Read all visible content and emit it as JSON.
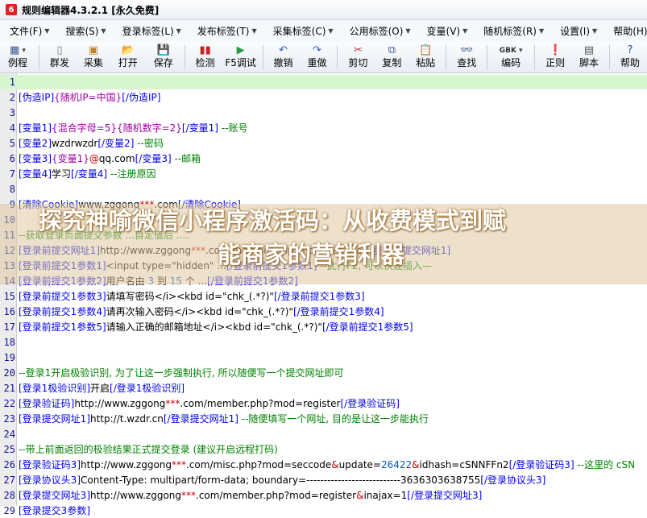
{
  "window": {
    "title": "规则编辑器4.3.2.1 [永久免费]",
    "icon_name": "app-logo-icon"
  },
  "menu": [
    {
      "label": "文件(F)",
      "arrow": "▼"
    },
    {
      "label": "搜索(S)",
      "arrow": "▼"
    },
    {
      "label": "登录标签(L)",
      "arrow": "▼"
    },
    {
      "label": "发布标签(T)",
      "arrow": "▼"
    },
    {
      "label": "采集标签(C)",
      "arrow": "▼"
    },
    {
      "label": "公用标签(O)",
      "arrow": "▼"
    },
    {
      "label": "变量(V)",
      "arrow": "▼"
    },
    {
      "label": "随机标签(R)",
      "arrow": "▼"
    },
    {
      "label": "设置(I)",
      "arrow": "▼"
    },
    {
      "label": "帮助(H)",
      "arrow": "▼"
    }
  ],
  "toolbar": [
    {
      "label": "例程",
      "icon": "grid-icon",
      "glyph": "▦",
      "color": "#3a5a90",
      "dropdown": "▾"
    },
    {
      "label": "群发",
      "icon": "page-icon",
      "glyph": "▯",
      "color": "#777777"
    },
    {
      "label": "采集",
      "icon": "collect-icon",
      "glyph": "▣",
      "color": "#c08020"
    },
    {
      "label": "打开",
      "icon": "folder-icon",
      "glyph": "📂",
      "color": "#d8a020"
    },
    {
      "label": "保存",
      "icon": "save-icon",
      "glyph": "💾",
      "color": "#3060b0"
    },
    {
      "label": "检测",
      "icon": "check-icon",
      "glyph": "▮▮",
      "color": "#cc2020"
    },
    {
      "label": "F5调试",
      "icon": "play-icon",
      "glyph": "▶",
      "color": "#20a040"
    },
    {
      "label": "撤销",
      "icon": "undo-icon",
      "glyph": "↶",
      "color": "#3060c0"
    },
    {
      "label": "重做",
      "icon": "redo-icon",
      "glyph": "↷",
      "color": "#3060c0"
    },
    {
      "label": "剪切",
      "icon": "cut-icon",
      "glyph": "✂",
      "color": "#c03030"
    },
    {
      "label": "复制",
      "icon": "copy-icon",
      "glyph": "⧉",
      "color": "#4060a0"
    },
    {
      "label": "粘贴",
      "icon": "paste-icon",
      "glyph": "📋",
      "color": "#a07030"
    },
    {
      "label": "查找",
      "icon": "binoculars-icon",
      "glyph": "👓",
      "color": "#333333"
    },
    {
      "label": "编码",
      "icon": "encoding-icon",
      "glyph": "GBK",
      "color": "#333333",
      "dropdown": "▾"
    },
    {
      "label": "正则",
      "icon": "regex-icon",
      "glyph": "❗",
      "color": "#c02020"
    },
    {
      "label": "脚本",
      "icon": "script-icon",
      "glyph": "▤",
      "color": "#555555"
    },
    {
      "label": "帮助",
      "icon": "help-icon",
      "glyph": "?",
      "color": "#2050b0"
    }
  ],
  "editor": {
    "lines": [
      {
        "n": "1",
        "segs": []
      },
      {
        "n": "2",
        "segs": [
          [
            "tag",
            "[伪造IP]"
          ],
          [
            "mag",
            "{随机IP=中国}"
          ],
          [
            "tag",
            "[/伪造IP]"
          ]
        ]
      },
      {
        "n": "3",
        "segs": []
      },
      {
        "n": "4",
        "segs": [
          [
            "tag",
            "[变量1]"
          ],
          [
            "mag",
            "{混合字母=5}{随机数字=2}"
          ],
          [
            "tag",
            "[/变量1]"
          ],
          [
            "cmt",
            " --账号"
          ]
        ]
      },
      {
        "n": "5",
        "segs": [
          [
            "tag",
            "[变量2]"
          ],
          [
            "str",
            "wzdrwzdr"
          ],
          [
            "tag",
            "[/变量2]"
          ],
          [
            "cmt",
            " --密码"
          ]
        ]
      },
      {
        "n": "6",
        "segs": [
          [
            "tag",
            "[变量3]"
          ],
          [
            "mag",
            "{变量1}"
          ],
          [
            "red",
            "@"
          ],
          [
            "str",
            "qq.com"
          ],
          [
            "tag",
            "[/变量3]"
          ],
          [
            "cmt",
            " --邮箱"
          ]
        ]
      },
      {
        "n": "7",
        "segs": [
          [
            "tag",
            "[变量4]"
          ],
          [
            "str",
            "学习"
          ],
          [
            "tag",
            "[/变量4]"
          ],
          [
            "cmt",
            " --注册原因"
          ]
        ]
      },
      {
        "n": "8",
        "segs": []
      },
      {
        "n": "9",
        "segs": [
          [
            "tag",
            "[清除Cookie]"
          ],
          [
            "str",
            "www.zggong"
          ],
          [
            "red",
            "***"
          ],
          [
            "str",
            ".com"
          ],
          [
            "tag",
            "[/清除Cookie]"
          ]
        ]
      },
      {
        "n": "10",
        "segs": []
      },
      {
        "n": "11",
        "segs": [
          [
            "cmt",
            "--获取登录页面提交参数 ...自定值后 ...."
          ]
        ]
      },
      {
        "n": "12",
        "segs": [
          [
            "tag",
            "[登录前提交网址1]"
          ],
          [
            "str",
            "http://www.zggong"
          ],
          [
            "red",
            "***"
          ],
          [
            "str",
            ".com/member.php?mod=register"
          ],
          [
            "tag",
            "[/登录前提交网址1]"
          ]
        ]
      },
      {
        "n": "13",
        "segs": [
          [
            "tag",
            "[登录前提交1参数1]"
          ],
          [
            "str",
            "<input type=\"hidden\" ..."
          ],
          [
            "tag",
            "[/登录前提交1参数1]"
          ],
          [
            "cmt",
            " --此行F2, 可以快速插入—"
          ]
        ]
      },
      {
        "n": "14",
        "segs": [
          [
            "tag",
            "[登录前提交1参数2]"
          ],
          [
            "str",
            "用户名由 "
          ],
          [
            "num",
            "3"
          ],
          [
            "str",
            " 到 "
          ],
          [
            "num",
            "15"
          ],
          [
            "str",
            " 个 ..."
          ],
          [
            "tag",
            "[/登录前提交1参数2]"
          ]
        ]
      },
      {
        "n": "15",
        "segs": [
          [
            "tag",
            "[登录前提交1参数3]"
          ],
          [
            "str",
            "请填写密码</i><kbd id=\"chk_(.*?)\""
          ],
          [
            "tag",
            "[/登录前提交1参数3]"
          ]
        ]
      },
      {
        "n": "16",
        "segs": [
          [
            "tag",
            "[登录前提交1参数4]"
          ],
          [
            "str",
            "请再次输入密码</i><kbd id=\"chk_(.*?)\""
          ],
          [
            "tag",
            "[/登录前提交1参数4]"
          ]
        ]
      },
      {
        "n": "17",
        "segs": [
          [
            "tag",
            "[登录前提交1参数5]"
          ],
          [
            "str",
            "请输入正确的邮箱地址</i><kbd id=\"chk_(.*?)\""
          ],
          [
            "tag",
            "[/登录前提交1参数5]"
          ]
        ]
      },
      {
        "n": "18",
        "segs": []
      },
      {
        "n": "19",
        "segs": []
      },
      {
        "n": "20",
        "segs": [
          [
            "cmt",
            "--登录1开启极验识别, 为了让这一步强制执行, 所以随便写一个提交网址即可"
          ]
        ]
      },
      {
        "n": "21",
        "segs": [
          [
            "tag",
            "[登录1极验识别]"
          ],
          [
            "str",
            "开启"
          ],
          [
            "tag",
            "[/登录1极验识别]"
          ]
        ]
      },
      {
        "n": "22",
        "segs": [
          [
            "tag",
            "[登录验证码]"
          ],
          [
            "str",
            "http://www.zggong"
          ],
          [
            "red",
            "***"
          ],
          [
            "str",
            ".com/member.php?mod=register"
          ],
          [
            "tag",
            "[/登录验证码]"
          ]
        ]
      },
      {
        "n": "23",
        "segs": [
          [
            "tag",
            "[登录提交网址1]"
          ],
          [
            "str",
            "http://t.wzdr.cn"
          ],
          [
            "tag",
            "[/登录提交网址1]"
          ],
          [
            "cmt",
            " --随便填写一个网址, 目的是让这一步能执行"
          ]
        ]
      },
      {
        "n": "24",
        "segs": []
      },
      {
        "n": "25",
        "segs": [
          [
            "cmt",
            "--带上前面返回的极验结果正式提交登录 (建议开启远程打码)"
          ]
        ]
      },
      {
        "n": "26",
        "segs": [
          [
            "tag",
            "[登录验证码3]"
          ],
          [
            "str",
            "http://www.zggong"
          ],
          [
            "red",
            "***"
          ],
          [
            "str",
            ".com/misc.php?mod=seccode"
          ],
          [
            "red",
            "&"
          ],
          [
            "str",
            "update="
          ],
          [
            "num",
            "26422"
          ],
          [
            "red",
            "&"
          ],
          [
            "str",
            "idhash=cSNNFFn2"
          ],
          [
            "tag",
            "[/登录验证码3]"
          ],
          [
            "cmt",
            " --这里的 cSN"
          ]
        ]
      },
      {
        "n": "27",
        "segs": [
          [
            "tag",
            "[登录协议头3]"
          ],
          [
            "str",
            "Content-Type: multipart/form-data; boundary=---------------------------3636303638755"
          ],
          [
            "tag",
            "[/登录协议头3]"
          ]
        ]
      },
      {
        "n": "28",
        "segs": [
          [
            "tag",
            "[登录提交网址3]"
          ],
          [
            "str",
            "http://www.zggong"
          ],
          [
            "red",
            "***"
          ],
          [
            "str",
            ".com/member.php?mod=register"
          ],
          [
            "red",
            "&"
          ],
          [
            "str",
            "inajax=1"
          ],
          [
            "tag",
            "[/登录提交网址3]"
          ]
        ]
      },
      {
        "n": "29",
        "segs": [
          [
            "tag",
            "[登录提交3参数]"
          ]
        ]
      }
    ]
  },
  "overlay": {
    "line1": "探究神喻微信小程序激活码：从收费模式到赋",
    "line2": "能商家的营销利器"
  }
}
